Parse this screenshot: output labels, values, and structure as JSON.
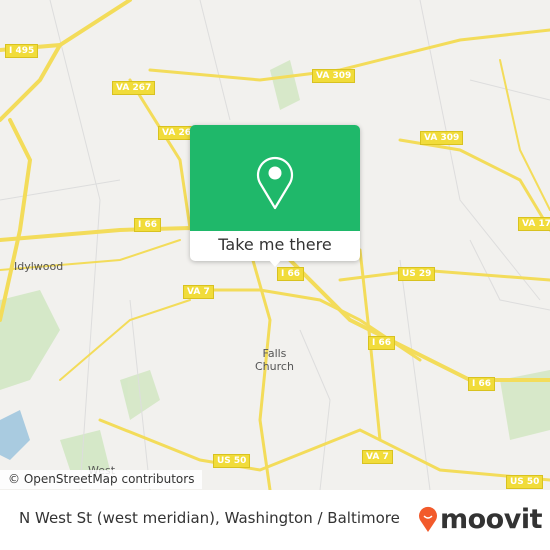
{
  "map": {
    "shields": [
      {
        "label": "I 495"
      },
      {
        "label": "VA 267"
      },
      {
        "label": "VA 309"
      },
      {
        "label": "VA 309"
      },
      {
        "label": "VA 26"
      },
      {
        "label": "I 66"
      },
      {
        "label": "I 66"
      },
      {
        "label": "VA 7"
      },
      {
        "label": "US 29"
      },
      {
        "label": "VA 17"
      },
      {
        "label": "I 66"
      },
      {
        "label": "I 66"
      },
      {
        "label": "US 50"
      },
      {
        "label": "VA 7"
      },
      {
        "label": "US 50"
      }
    ],
    "places": {
      "idylwood": "Idylwood",
      "falls_church": "Falls\nChurch",
      "west": "West"
    },
    "attribution": "© OpenStreetMap contributors",
    "colors": {
      "road": "#f3dc5a",
      "land": "#f2f1ee",
      "park": "#cfe6bf",
      "water": "#a9cbe0"
    }
  },
  "popup": {
    "button_label": "Take me there",
    "color": "#1fb86a"
  },
  "footer": {
    "title": "N West St (west meridian), Washington / Baltimore",
    "brand": "moovit",
    "brand_color": "#f25a2b"
  }
}
